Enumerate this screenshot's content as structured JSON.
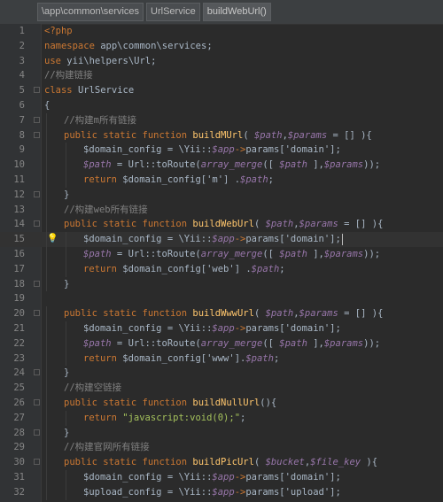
{
  "breadcrumbs": [
    "\\app\\common\\services",
    "UrlService",
    "buildWebUrl()"
  ],
  "current_line": 15,
  "colors": {
    "background": "#2b2b2b",
    "gutter": "#313335",
    "keyword": "#cc7832",
    "variable": "#9876aa",
    "string": "#a5c25c",
    "comment": "#808080",
    "function": "#ffc66d",
    "plain": "#a9b7c6"
  },
  "lines": [
    {
      "n": "1",
      "indent": 0,
      "tokens": [
        [
          "tag",
          "<?php"
        ]
      ]
    },
    {
      "n": "2",
      "indent": 0,
      "tokens": [
        [
          "kw",
          "namespace "
        ],
        [
          "plain",
          "app\\common\\services;"
        ]
      ]
    },
    {
      "n": "3",
      "indent": 0,
      "tokens": [
        [
          "kw",
          "use "
        ],
        [
          "plain",
          "yii\\helpers\\Url;"
        ]
      ]
    },
    {
      "n": "4",
      "indent": 0,
      "tokens": [
        [
          "cmt",
          "//构建链接"
        ]
      ]
    },
    {
      "n": "5",
      "indent": 0,
      "fold": true,
      "tokens": [
        [
          "kw",
          "class "
        ],
        [
          "plain",
          "UrlService"
        ]
      ]
    },
    {
      "n": "6",
      "indent": 0,
      "tokens": [
        [
          "plain",
          "{"
        ]
      ]
    },
    {
      "n": "7",
      "indent": 1,
      "fold": true,
      "tokens": [
        [
          "cmt",
          "//构建m所有链接"
        ]
      ]
    },
    {
      "n": "8",
      "indent": 1,
      "fold": true,
      "tokens": [
        [
          "kw",
          "public static function "
        ],
        [
          "fn",
          "buildMUrl"
        ],
        [
          "plain",
          "( "
        ],
        [
          "var",
          "$path"
        ],
        [
          "plain",
          ","
        ],
        [
          "var",
          "$params"
        ],
        [
          "plain",
          " = [] ){"
        ]
      ]
    },
    {
      "n": "9",
      "indent": 2,
      "tokens": [
        [
          "plain",
          "$domain_config = \\Yii::"
        ],
        [
          "var",
          "$app"
        ],
        [
          "kw",
          "->"
        ],
        [
          "plain",
          "params['domain'];"
        ]
      ]
    },
    {
      "n": "10",
      "indent": 2,
      "tokens": [
        [
          "var",
          "$path"
        ],
        [
          "plain",
          " = Url::toRoute("
        ],
        [
          "it",
          "array_merge"
        ],
        [
          "plain",
          "([ "
        ],
        [
          "var",
          "$path"
        ],
        [
          "plain",
          " ],"
        ],
        [
          "var",
          "$params"
        ],
        [
          "plain",
          "));"
        ]
      ]
    },
    {
      "n": "11",
      "indent": 2,
      "tokens": [
        [
          "kw",
          "return "
        ],
        [
          "plain",
          "$domain_config['m'] ."
        ],
        [
          "var",
          "$path"
        ],
        [
          "plain",
          ";"
        ]
      ]
    },
    {
      "n": "12",
      "indent": 1,
      "fold": true,
      "tokens": [
        [
          "plain",
          "}"
        ]
      ]
    },
    {
      "n": "13",
      "indent": 1,
      "tokens": [
        [
          "cmt",
          "//构建web所有链接"
        ]
      ]
    },
    {
      "n": "14",
      "indent": 1,
      "fold": true,
      "tokens": [
        [
          "kw",
          "public static function "
        ],
        [
          "fn",
          "buildWebUrl"
        ],
        [
          "plain",
          "( "
        ],
        [
          "var",
          "$path"
        ],
        [
          "plain",
          ","
        ],
        [
          "var",
          "$params"
        ],
        [
          "plain",
          " = [] ){"
        ]
      ]
    },
    {
      "n": "15",
      "indent": 2,
      "bulb": true,
      "caret": true,
      "tokens": [
        [
          "plain",
          "$domain_config = \\Yii::"
        ],
        [
          "var",
          "$app"
        ],
        [
          "kw",
          "->"
        ],
        [
          "plain",
          "params['domain'];"
        ]
      ]
    },
    {
      "n": "16",
      "indent": 2,
      "tokens": [
        [
          "var",
          "$path"
        ],
        [
          "plain",
          " = Url::toRoute("
        ],
        [
          "it",
          "array_merge"
        ],
        [
          "plain",
          "([ "
        ],
        [
          "var",
          "$path"
        ],
        [
          "plain",
          " ],"
        ],
        [
          "var",
          "$params"
        ],
        [
          "plain",
          "));"
        ]
      ]
    },
    {
      "n": "17",
      "indent": 2,
      "tokens": [
        [
          "kw",
          "return "
        ],
        [
          "plain",
          "$domain_config['web'] ."
        ],
        [
          "var",
          "$path"
        ],
        [
          "plain",
          ";"
        ]
      ]
    },
    {
      "n": "18",
      "indent": 1,
      "fold": true,
      "tokens": [
        [
          "plain",
          "}"
        ]
      ]
    },
    {
      "n": "19",
      "indent": 0,
      "tokens": []
    },
    {
      "n": "20",
      "indent": 1,
      "fold": true,
      "tokens": [
        [
          "kw",
          "public static function "
        ],
        [
          "fn",
          "buildWwwUrl"
        ],
        [
          "plain",
          "( "
        ],
        [
          "var",
          "$path"
        ],
        [
          "plain",
          ","
        ],
        [
          "var",
          "$params"
        ],
        [
          "plain",
          " = [] ){"
        ]
      ]
    },
    {
      "n": "21",
      "indent": 2,
      "tokens": [
        [
          "plain",
          "$domain_config = \\Yii::"
        ],
        [
          "var",
          "$app"
        ],
        [
          "kw",
          "->"
        ],
        [
          "plain",
          "params['domain'];"
        ]
      ]
    },
    {
      "n": "22",
      "indent": 2,
      "tokens": [
        [
          "var",
          "$path"
        ],
        [
          "plain",
          " = Url::toRoute("
        ],
        [
          "it",
          "array_merge"
        ],
        [
          "plain",
          "([ "
        ],
        [
          "var",
          "$path"
        ],
        [
          "plain",
          " ],"
        ],
        [
          "var",
          "$params"
        ],
        [
          "plain",
          "));"
        ]
      ]
    },
    {
      "n": "23",
      "indent": 2,
      "tokens": [
        [
          "kw",
          "return "
        ],
        [
          "plain",
          "$domain_config['www']."
        ],
        [
          "var",
          "$path"
        ],
        [
          "plain",
          ";"
        ]
      ]
    },
    {
      "n": "24",
      "indent": 1,
      "fold": true,
      "tokens": [
        [
          "plain",
          "}"
        ]
      ]
    },
    {
      "n": "25",
      "indent": 1,
      "tokens": [
        [
          "cmt",
          "//构建空链接"
        ]
      ]
    },
    {
      "n": "26",
      "indent": 1,
      "fold": true,
      "tokens": [
        [
          "kw",
          "public static function "
        ],
        [
          "fn",
          "buildNullUrl"
        ],
        [
          "plain",
          "(){"
        ]
      ]
    },
    {
      "n": "27",
      "indent": 2,
      "tokens": [
        [
          "kw",
          "return "
        ],
        [
          "str",
          "\"javascript:void(0);\""
        ],
        [
          "plain",
          ";"
        ]
      ]
    },
    {
      "n": "28",
      "indent": 1,
      "fold": true,
      "tokens": [
        [
          "plain",
          "}"
        ]
      ]
    },
    {
      "n": "29",
      "indent": 1,
      "tokens": [
        [
          "cmt",
          "//构建官网所有链接"
        ]
      ]
    },
    {
      "n": "30",
      "indent": 1,
      "fold": true,
      "tokens": [
        [
          "kw",
          "public static function "
        ],
        [
          "fn",
          "buildPicUrl"
        ],
        [
          "plain",
          "( "
        ],
        [
          "var",
          "$bucket"
        ],
        [
          "plain",
          ","
        ],
        [
          "var",
          "$file_key"
        ],
        [
          "plain",
          " ){"
        ]
      ]
    },
    {
      "n": "31",
      "indent": 2,
      "tokens": [
        [
          "plain",
          "$domain_config = \\Yii::"
        ],
        [
          "var",
          "$app"
        ],
        [
          "kw",
          "->"
        ],
        [
          "plain",
          "params['domain'];"
        ]
      ]
    },
    {
      "n": "32",
      "indent": 2,
      "tokens": [
        [
          "plain",
          "$upload_config = \\Yii::"
        ],
        [
          "var",
          "$app"
        ],
        [
          "kw",
          "->"
        ],
        [
          "plain",
          "params['upload'];"
        ]
      ]
    }
  ]
}
